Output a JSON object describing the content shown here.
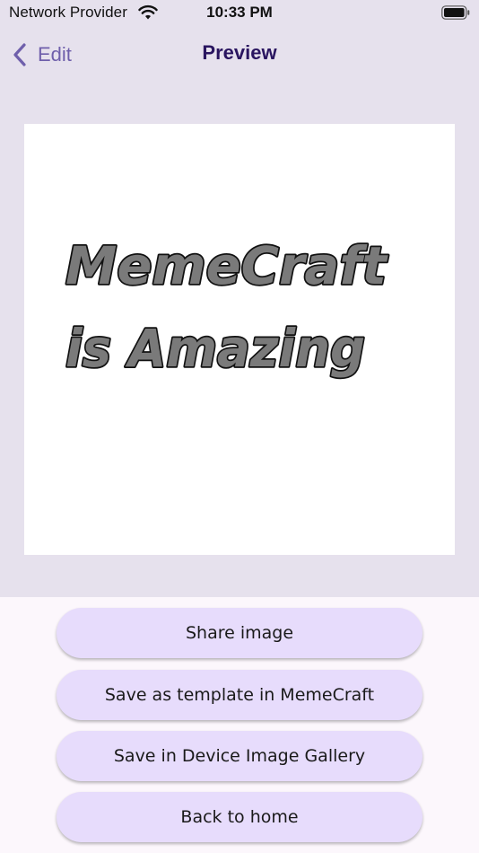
{
  "status_bar": {
    "carrier": "Network Provider",
    "time": "10:33 PM",
    "wifi_icon": "wifi-icon",
    "battery_icon": "battery-icon"
  },
  "nav": {
    "back_label": "Edit",
    "back_icon": "chevron-left-icon",
    "title": "Preview"
  },
  "preview": {
    "line1": "MemeCraft",
    "line2": "is Amazing"
  },
  "actions": {
    "share": "Share image",
    "save_template": "Save as template in MemeCraft",
    "save_gallery": "Save in Device Image Gallery",
    "back_home": "Back to home"
  },
  "colors": {
    "top_background": "#e6e1ed",
    "bottom_background": "#fcf7fc",
    "button_fill": "#e7dcfc",
    "accent": "#6f5fab",
    "title": "#2a1560",
    "meme_fill": "#7a7a7a",
    "meme_outline": "#111111"
  }
}
